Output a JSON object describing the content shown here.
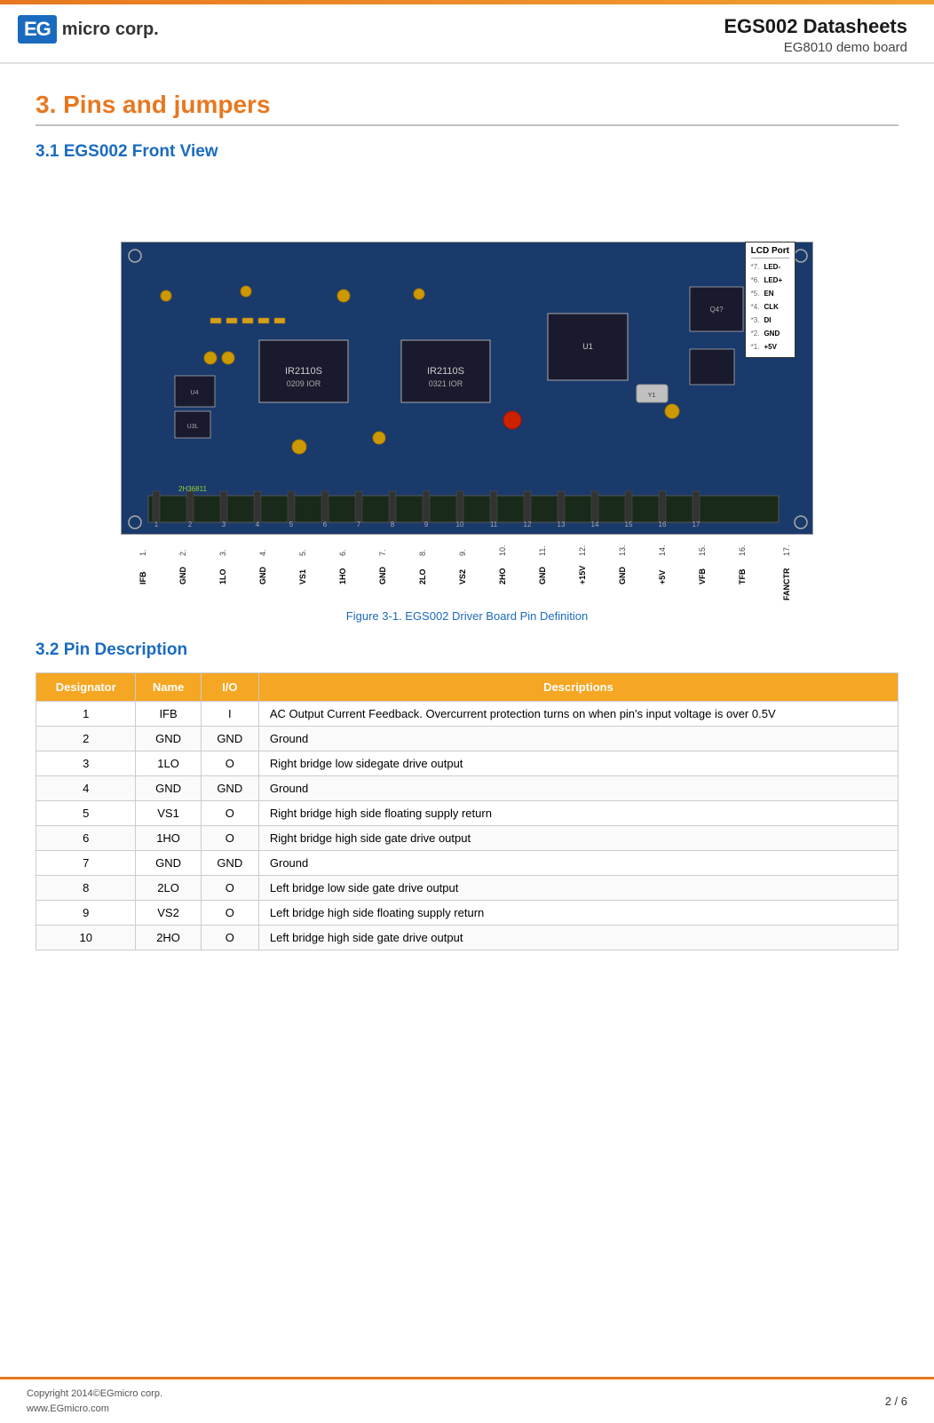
{
  "header": {
    "logo_box": "EG",
    "logo_text": "micro corp.",
    "title": "EGS002 Datasheets",
    "subtitle": "EG8010 demo board"
  },
  "section3": {
    "heading": "3. Pins and jumpers",
    "subsection31": {
      "heading": "3.1   EGS002 Front View",
      "figure_caption": "Figure 3-1. EGS002 Driver Board Pin Definition"
    },
    "subsection32": {
      "heading": "3.2   Pin Description"
    }
  },
  "lcd_port": {
    "title": "LCD Port",
    "pins": [
      {
        "num": "*7.",
        "sig": "LED-"
      },
      {
        "num": "*6.",
        "sig": "LED+"
      },
      {
        "num": "*5.",
        "sig": "EN"
      },
      {
        "num": "*4.",
        "sig": "CLK"
      },
      {
        "num": "*3.",
        "sig": "DI"
      },
      {
        "num": "*2.",
        "sig": "GND"
      },
      {
        "num": "*1.",
        "sig": "+5V"
      }
    ]
  },
  "bottom_pins": [
    {
      "num": "1.",
      "name": "IFB"
    },
    {
      "num": "2.",
      "name": "GND"
    },
    {
      "num": "3.",
      "name": "1LO"
    },
    {
      "num": "4.",
      "name": "GND"
    },
    {
      "num": "5.",
      "name": "VS1"
    },
    {
      "num": "6.",
      "name": "1HO"
    },
    {
      "num": "7.",
      "name": "GND"
    },
    {
      "num": "8.",
      "name": "2LO"
    },
    {
      "num": "9.",
      "name": "VS2"
    },
    {
      "num": "10.",
      "name": "2HO"
    },
    {
      "num": "11.",
      "name": "GND"
    },
    {
      "num": "12.",
      "name": "+15V"
    },
    {
      "num": "13.",
      "name": "GND"
    },
    {
      "num": "14.",
      "name": "+5V"
    },
    {
      "num": "15.",
      "name": "VFB"
    },
    {
      "num": "16.",
      "name": "TFB"
    },
    {
      "num": "17.",
      "name": "FANCTR"
    }
  ],
  "table": {
    "headers": [
      "Designator",
      "Name",
      "I/O",
      "Descriptions"
    ],
    "rows": [
      {
        "designator": "1",
        "name": "IFB",
        "io": "I",
        "desc": "AC Output Current Feedback. Overcurrent protection turns on when pin's input voltage is over 0.5V"
      },
      {
        "designator": "2",
        "name": "GND",
        "io": "GND",
        "desc": "Ground"
      },
      {
        "designator": "3",
        "name": "1LO",
        "io": "O",
        "desc": "Right bridge low sidegate drive output"
      },
      {
        "designator": "4",
        "name": "GND",
        "io": "GND",
        "desc": "Ground"
      },
      {
        "designator": "5",
        "name": "VS1",
        "io": "O",
        "desc": "Right bridge high side floating supply return"
      },
      {
        "designator": "6",
        "name": "1HO",
        "io": "O",
        "desc": "Right bridge high side gate drive output"
      },
      {
        "designator": "7",
        "name": "GND",
        "io": "GND",
        "desc": "Ground"
      },
      {
        "designator": "8",
        "name": "2LO",
        "io": "O",
        "desc": "Left bridge low side gate drive output"
      },
      {
        "designator": "9",
        "name": "VS2",
        "io": "O",
        "desc": "Left bridge high side floating supply return"
      },
      {
        "designator": "10",
        "name": "2HO",
        "io": "O",
        "desc": "Left bridge high side gate drive output"
      }
    ]
  },
  "footer": {
    "left_line1": "Copyright 2014©EGmicro corp.",
    "left_line2": "www.EGmicro.com",
    "right": "2 / 6"
  }
}
